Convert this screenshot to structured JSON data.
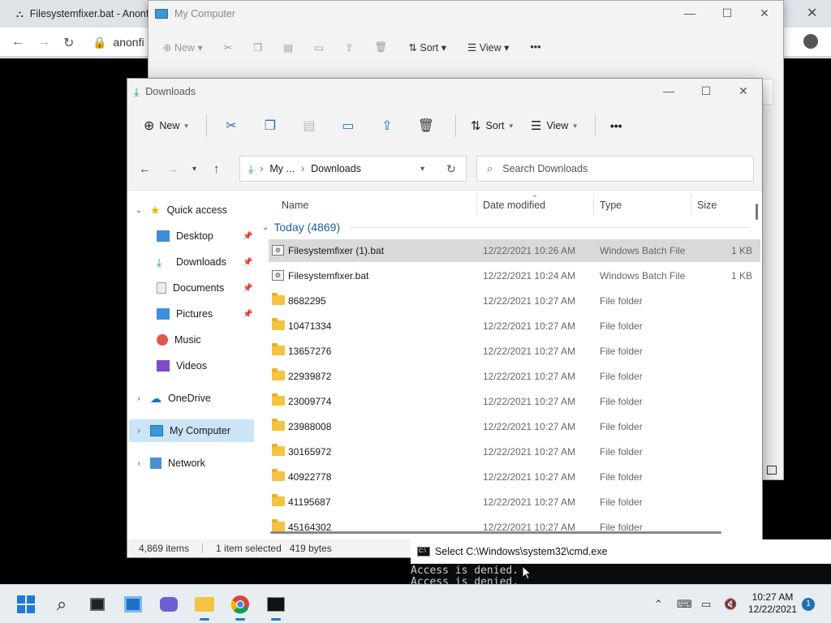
{
  "browser": {
    "tab_title": "Filesystemfixer.bat - Anonfi",
    "url_fragment": "anonfi"
  },
  "back_window": {
    "title": "My Computer",
    "new_label": "New",
    "sort_label": "Sort",
    "view_label": "View"
  },
  "window": {
    "title": "Downloads",
    "toolbar": {
      "new_label": "New",
      "sort_label": "Sort",
      "view_label": "View",
      "more_label": "•••"
    },
    "breadcrumb": {
      "parent": "My ...",
      "current": "Downloads"
    },
    "search": {
      "placeholder": "Search Downloads"
    },
    "nav": {
      "quick_access": "Quick access",
      "desktop": "Desktop",
      "downloads": "Downloads",
      "documents": "Documents",
      "pictures": "Pictures",
      "music": "Music",
      "videos": "Videos",
      "onedrive": "OneDrive",
      "my_computer": "My Computer",
      "network": "Network"
    },
    "columns": {
      "name": "Name",
      "date": "Date modified",
      "type": "Type",
      "size": "Size"
    },
    "group_header": "Today (4869)",
    "files": [
      {
        "name": "Filesystemfixer (1).bat",
        "date": "12/22/2021 10:26 AM",
        "type": "Windows Batch File",
        "size": "1 KB",
        "kind": "bat"
      },
      {
        "name": "Filesystemfixer.bat",
        "date": "12/22/2021 10:24 AM",
        "type": "Windows Batch File",
        "size": "1 KB",
        "kind": "bat"
      },
      {
        "name": "8682295",
        "date": "12/22/2021 10:27 AM",
        "type": "File folder",
        "size": "",
        "kind": "folder"
      },
      {
        "name": "10471334",
        "date": "12/22/2021 10:27 AM",
        "type": "File folder",
        "size": "",
        "kind": "folder"
      },
      {
        "name": "13657276",
        "date": "12/22/2021 10:27 AM",
        "type": "File folder",
        "size": "",
        "kind": "folder"
      },
      {
        "name": "22939872",
        "date": "12/22/2021 10:27 AM",
        "type": "File folder",
        "size": "",
        "kind": "folder"
      },
      {
        "name": "23009774",
        "date": "12/22/2021 10:27 AM",
        "type": "File folder",
        "size": "",
        "kind": "folder"
      },
      {
        "name": "23988008",
        "date": "12/22/2021 10:27 AM",
        "type": "File folder",
        "size": "",
        "kind": "folder"
      },
      {
        "name": "30165972",
        "date": "12/22/2021 10:27 AM",
        "type": "File folder",
        "size": "",
        "kind": "folder"
      },
      {
        "name": "40922778",
        "date": "12/22/2021 10:27 AM",
        "type": "File folder",
        "size": "",
        "kind": "folder"
      },
      {
        "name": "41195687",
        "date": "12/22/2021 10:27 AM",
        "type": "File folder",
        "size": "",
        "kind": "folder"
      },
      {
        "name": "45164302",
        "date": "12/22/2021 10:27 AM",
        "type": "File folder",
        "size": "",
        "kind": "folder"
      }
    ],
    "status": {
      "items": "4,869 items",
      "selected": "1 item selected",
      "bytes": "419 bytes"
    }
  },
  "cmd": {
    "title": "Select C:\\Windows\\system32\\cmd.exe",
    "lines": [
      "Access is denied.",
      "Access is denied."
    ]
  },
  "taskbar": {
    "time": "10:27 AM",
    "date": "12/22/2021",
    "notifications": "1"
  }
}
